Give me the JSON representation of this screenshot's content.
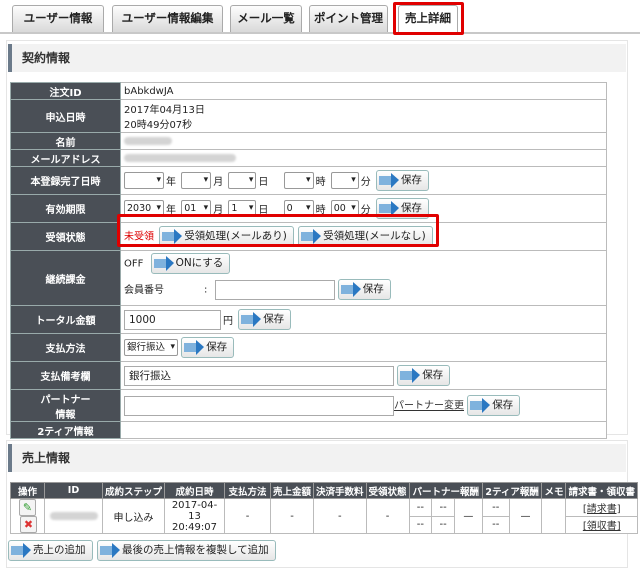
{
  "tabs": [
    {
      "label": "ユーザー情報"
    },
    {
      "label": "ユーザー情報編集"
    },
    {
      "label": "メール一覧"
    },
    {
      "label": "ポイント管理"
    },
    {
      "label": "売上詳細"
    }
  ],
  "contract": {
    "title": "契約情報",
    "order_id_label": "注文ID",
    "order_id": "bAbkdwJA",
    "applied_label": "申込日時",
    "applied_date": "2017年04月13日",
    "applied_time": "20時49分07秒",
    "name_label": "名前",
    "email_label": "メールアドレス",
    "registered_label": "本登録完了日時",
    "expiry_label": "有効期限",
    "expiry": {
      "year": "2030",
      "month": "01",
      "day": "1",
      "hour": "0",
      "minute": "00"
    },
    "unit_year": "年",
    "unit_month": "月",
    "unit_day": "日",
    "unit_hour": "時",
    "unit_minute": "分",
    "save_label": "保存",
    "receipt_label": "受領状態",
    "receipt_status": "未受領",
    "receipt_btn_mail": "受領処理(メールあり)",
    "receipt_btn_nomail": "受領処理(メールなし)",
    "billing_label": "継続課金",
    "billing_status": "OFF",
    "billing_on_btn": "ONにする",
    "member_no_label": "会員番号",
    "member_no_colon": ":",
    "total_label": "トータル金額",
    "total_value": "1000",
    "total_unit": "円",
    "payment_label": "支払方法",
    "payment_value": "銀行振込",
    "payment_note_label": "支払備考欄",
    "payment_note_value": "銀行振込",
    "partner_label_1": "パートナー",
    "partner_label_2": "情報",
    "partner_change_link": "パートナー変更",
    "tier2_label": "2ティア情報"
  },
  "sales": {
    "title": "売上情報",
    "headers": [
      "操作",
      "ID",
      "成約ステップ",
      "成約日時",
      "支払方法",
      "売上金額",
      "決済手数料",
      "受領状態",
      "パートナー報酬",
      "2ティア報酬",
      "メモ",
      "請求書・領収書"
    ],
    "row": {
      "step": "申し込み",
      "date": "2017-04-13",
      "time": "20:49:07",
      "payment": "-",
      "amount": "-",
      "fee": "-",
      "receipt": "-",
      "partner_a": "--",
      "partner_b": "--",
      "partner_c": "--",
      "partner_d": "--",
      "partner_dash": "—",
      "tier2_dash": "—",
      "invoice": "[請求書]",
      "receipt_doc": "[領収書]"
    },
    "add_btn": "売上の追加",
    "copy_btn": "最後の売上情報を複製して追加"
  }
}
